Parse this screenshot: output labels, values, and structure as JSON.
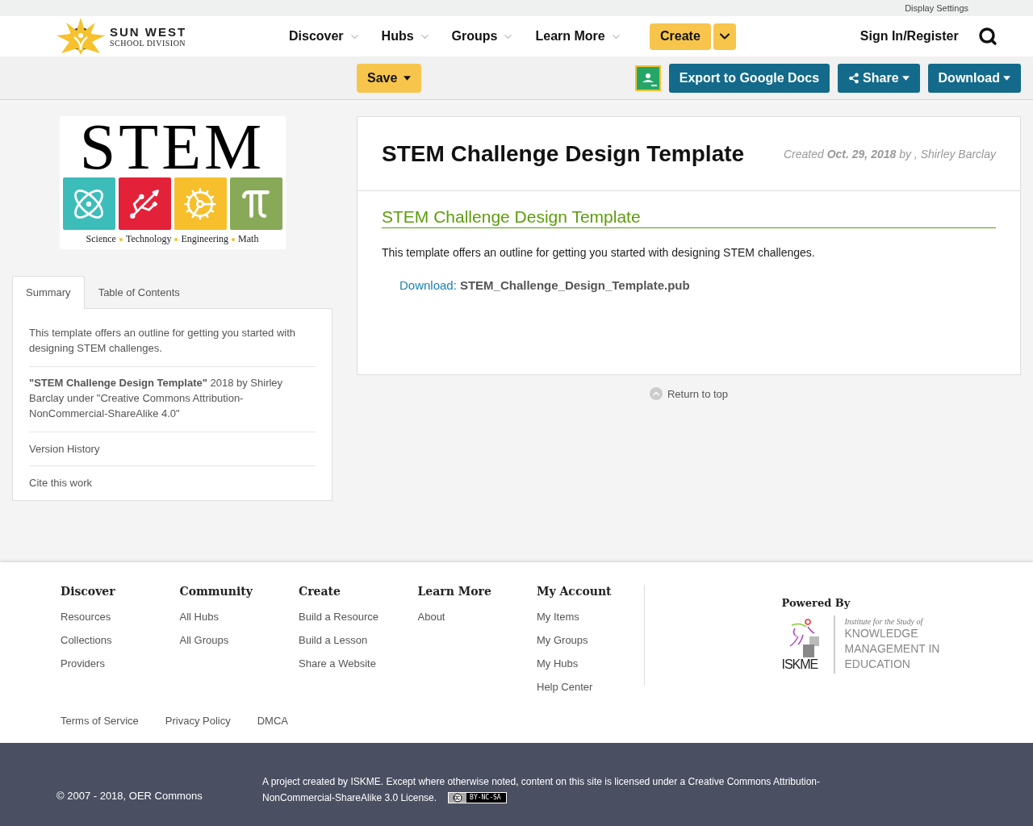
{
  "top_bar": {
    "link": "Display Settings"
  },
  "header": {
    "logo": {
      "name": "SUN WEST",
      "subtitle": "SCHOOL DIVISION"
    },
    "nav": [
      {
        "label": "Discover"
      },
      {
        "label": "Hubs"
      },
      {
        "label": "Groups"
      },
      {
        "label": "Learn More"
      }
    ],
    "create": "Create",
    "sign_in": "Sign In/Register"
  },
  "toolbar": {
    "save": "Save",
    "export": "Export to Google Docs",
    "share": "Share",
    "download": "Download"
  },
  "thumbnail": {
    "title": "STEM",
    "tiles": [
      {
        "kind": "atom",
        "color": "#3dbdb9"
      },
      {
        "kind": "usb",
        "color": "#e3223a"
      },
      {
        "kind": "gears",
        "color": "#f6bf2b"
      },
      {
        "kind": "pi",
        "color": "#88a957"
      }
    ],
    "caption": [
      "Science",
      "Technology",
      "Engineering",
      "Math"
    ]
  },
  "tabs": [
    {
      "label": "Summary",
      "selected": true
    },
    {
      "label": "Table of Contents",
      "selected": false
    }
  ],
  "summary": {
    "description": "This template offers an outline for getting you started with designing STEM challenges.",
    "attribution": "**\"STEM Challenge Design Template\"** 2018 by Shirley Barclay under \"Creative Commons Attribution-NonCommercial-ShareAlike 4.0\"",
    "links": [
      "Version History",
      "Cite this work"
    ]
  },
  "resource": {
    "title": "STEM Challenge Design Template",
    "created": "Created **Oct. 29, 2018** by , Shirley Barclay",
    "section_title": "STEM Challenge Design Template",
    "description": "This template offers an outline for getting you started with designing STEM challenges.",
    "download_label": "Download:",
    "file": "STEM_Challenge_Design_Template.pub"
  },
  "return_to_top": "Return to top",
  "footer": {
    "columns": [
      {
        "heading": "Discover",
        "links": [
          "Resources",
          "Collections",
          "Providers"
        ]
      },
      {
        "heading": "Community",
        "links": [
          "All Hubs",
          "All Groups"
        ]
      },
      {
        "heading": "Create",
        "links": [
          "Build a Resource",
          "Build a Lesson",
          "Share a Website"
        ]
      },
      {
        "heading": "Learn More",
        "links": [
          "About"
        ]
      },
      {
        "heading": "My Account",
        "links": [
          "My Items",
          "My Groups",
          "My Hubs",
          "Help Center"
        ]
      }
    ],
    "powered_by": "Powered By",
    "partner": {
      "acronym": "ISKME",
      "tagline": "Institute for the Study of",
      "name": "KNOWLEDGE MANAGEMENT IN EDUCATION"
    },
    "legal_links": [
      "Terms of Service",
      "Privacy Policy",
      "DMCA"
    ],
    "copyright": "© 2007 - 2018, OER Commons",
    "notice_lines": [
      "A project created by ISKME. Except where otherwise noted, content on this site is licensed under a Creative Commons Attribution-",
      "NonCommercial-ShareAlike 3.0 License."
    ],
    "license_badge": "BY-NC-SA"
  }
}
